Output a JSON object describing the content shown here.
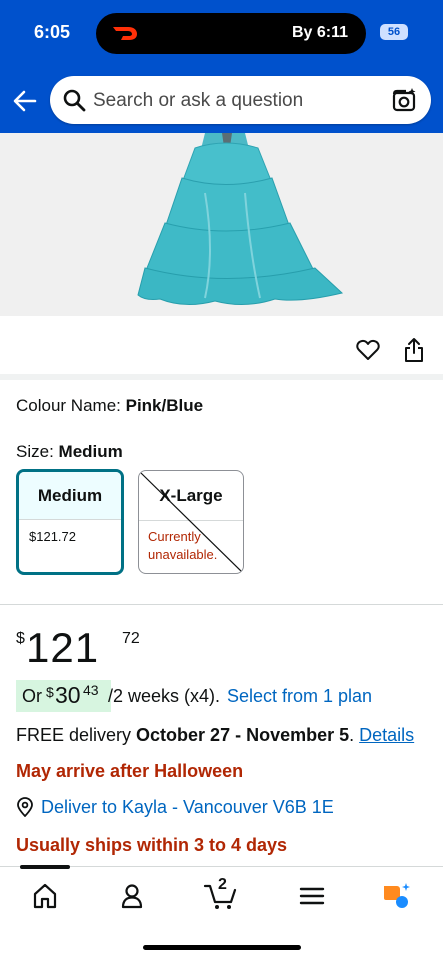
{
  "status_bar": {
    "time": "6:05",
    "live_activity_text": "By 6:11",
    "battery": "56",
    "live_activity_icon": "doordash-logo-icon"
  },
  "header": {
    "search_placeholder": "Search or ask a question",
    "back_icon": "back-arrow-icon",
    "search_icon": "search-icon",
    "camera_icon": "camera-lens-icon",
    "bg_color": "#0051cc"
  },
  "product": {
    "colour_label": "Colour Name:",
    "colour_value": "Pink/Blue",
    "size_label": "Size:",
    "size_value": "Medium",
    "sizes": [
      {
        "name": "Medium",
        "price": "$121.72",
        "selected": true
      },
      {
        "name": "X-Large",
        "note": "Currently unavailable.",
        "selected": false
      }
    ]
  },
  "price": {
    "currency": "$",
    "whole": "121",
    "fraction": "72"
  },
  "installment": {
    "or": "Or",
    "currency": "$",
    "whole": "30",
    "fraction": "43",
    "period": "/2 weeks (x4).",
    "plan_link": "Select from 1 plan"
  },
  "delivery": {
    "prefix": "FREE delivery",
    "dates": "October 27 - November 5",
    "link": "Details"
  },
  "notices": {
    "halloween": "May arrive after Halloween",
    "ships": "Usually ships within 3 to 4 days"
  },
  "deliver_to": {
    "text": "Deliver to Kayla - Vancouver V6B 1E"
  },
  "bottom_nav": {
    "cart_count": "2",
    "items": [
      "home-icon",
      "account-icon",
      "cart-icon",
      "menu-icon",
      "rufus-icon"
    ]
  },
  "colors": {
    "accent_link": "#0066c0",
    "warning": "#b12704",
    "selected_border": "#007185"
  }
}
